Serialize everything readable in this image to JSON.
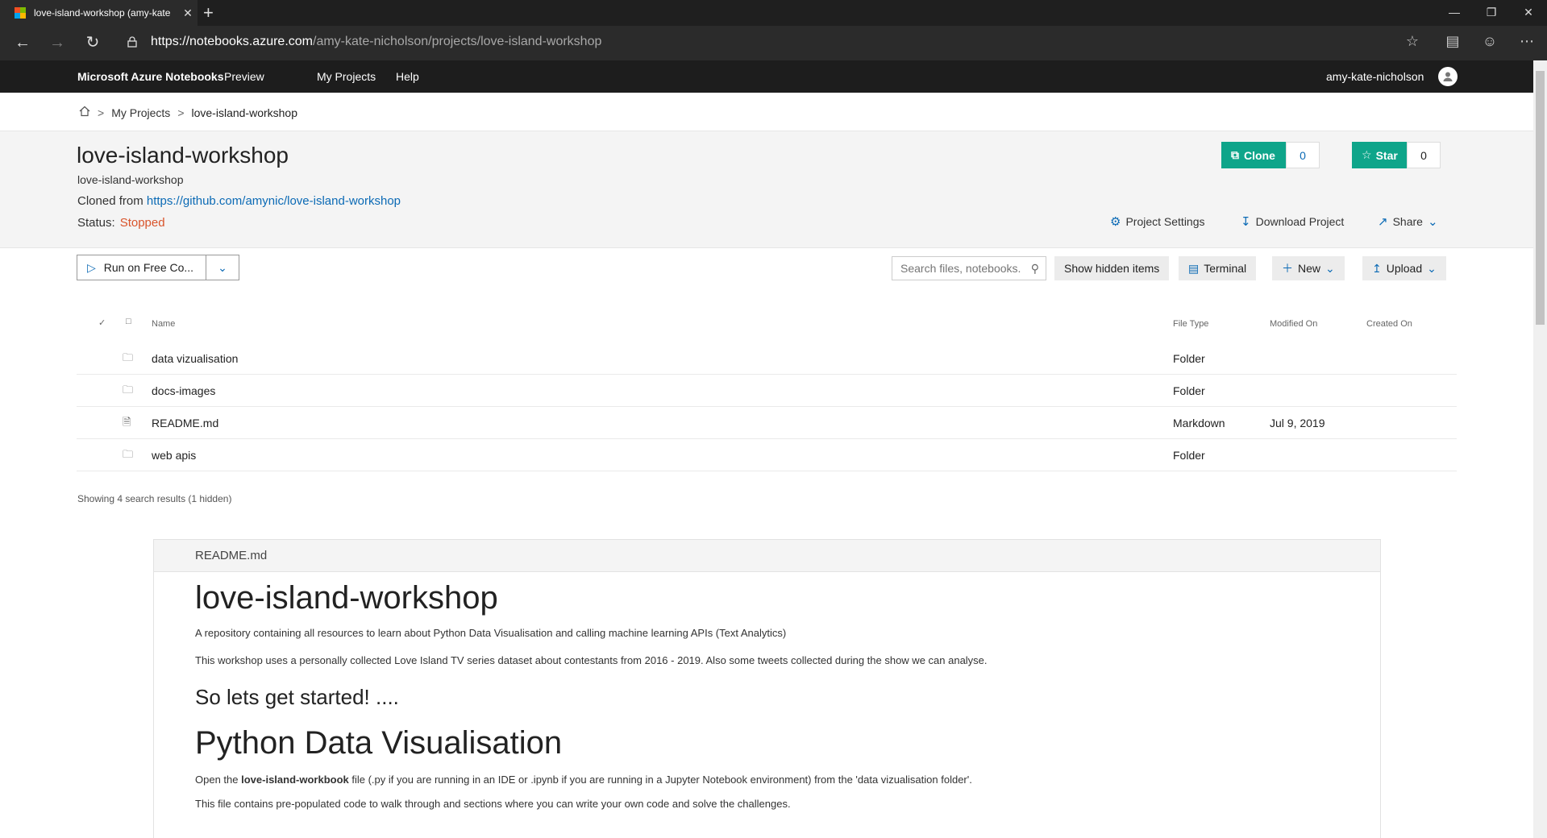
{
  "browser": {
    "tab_title": "love-island-workshop (amy-kate",
    "tab_close": "✕",
    "new_tab": "+",
    "url_host": "https://notebooks.azure.com",
    "url_path": "/amy-kate-nicholson/projects/love-island-workshop",
    "icons": [
      "back-icon",
      "forward-icon",
      "refresh-icon",
      "lock-icon",
      "favorite-star-icon",
      "reading-list-icon",
      "feedback-smiley-icon",
      "more-icon"
    ]
  },
  "topnav": {
    "brand": "Microsoft Azure Notebooks",
    "preview": "Preview",
    "my_projects": "My Projects",
    "help": "Help",
    "username": "amy-kate-nicholson"
  },
  "breadcrumb": {
    "sep": ">",
    "my_projects": "My Projects",
    "current": "love-island-workshop"
  },
  "project": {
    "title": "love-island-workshop",
    "subtitle": "love-island-workshop",
    "cloned_label": "Cloned from",
    "cloned_url": "https://github.com/amynic/love-island-workshop",
    "status_label": "Status:",
    "status_value": "Stopped",
    "clone_label": "Clone",
    "clone_count": "0",
    "star_label": "Star",
    "star_count": "0",
    "settings_label": "Project Settings",
    "download_label": "Download Project",
    "share_label": "Share"
  },
  "toolbar": {
    "run_label": "Run on Free Co...",
    "search_placeholder": "Search files, notebooks...",
    "show_hidden": "Show hidden items",
    "terminal": "Terminal",
    "new": "New",
    "upload": "Upload"
  },
  "table": {
    "headers": {
      "name": "Name",
      "file_type": "File Type",
      "modified": "Modified On",
      "created": "Created On"
    },
    "rows": [
      {
        "name": "data vizualisation",
        "type": "Folder",
        "modified": "",
        "icon": "folder-icon"
      },
      {
        "name": "docs-images",
        "type": "Folder",
        "modified": "",
        "icon": "folder-icon"
      },
      {
        "name": "README.md",
        "type": "Markdown",
        "modified": "Jul 9, 2019",
        "icon": "file-icon"
      },
      {
        "name": "web apis",
        "type": "Folder",
        "modified": "",
        "icon": "folder-icon"
      }
    ],
    "showing": "Showing 4 search results (1 hidden)"
  },
  "readme": {
    "filename": "README.md",
    "h1": "love-island-workshop",
    "p1": "A repository containing all resources to learn about Python Data Visualisation and calling machine learning APIs (Text Analytics)",
    "p2": "This workshop uses a personally collected Love Island TV series dataset about contestants from 2016 - 2019. Also some tweets collected during the show we can analyse.",
    "h2": "So lets get started! ....",
    "h1b": "Python Data Visualisation",
    "p3_pre": "Open the ",
    "p3_bold": "love-island-workbook",
    "p3_post": " file (.py if you are running in an IDE or .ipynb if you are running in a Jupyter Notebook environment) from the 'data vizualisation folder'.",
    "p4": "This file contains pre-populated code to walk through and sections where you can write your own code and solve the challenges."
  },
  "colors": {
    "accent": "#0fa58a",
    "link": "#0b6ab5",
    "stopped": "#d9542b"
  }
}
